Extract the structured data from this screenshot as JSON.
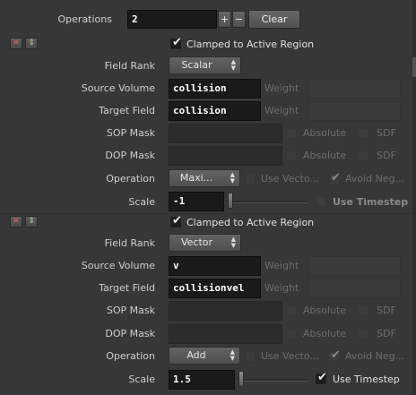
{
  "header": {
    "operations_label": "Operations",
    "operations_count": "2",
    "plus_label": "+",
    "minus_label": "−",
    "clear_label": "Clear"
  },
  "blocks": [
    {
      "close_icon": "close-icon",
      "move_icon": "up-down-icon",
      "clamped_label": "Clamped to Active Region",
      "clamped_checked": true,
      "field_rank_label": "Field Rank",
      "field_rank_value": "Scalar",
      "source_volume_label": "Source Volume",
      "source_volume_value": "collision",
      "source_weight_label": "Weight",
      "target_field_label": "Target Field",
      "target_field_value": "collision",
      "target_weight_label": "Weight",
      "sop_mask_label": "SOP Mask",
      "sop_absolute_label": "Absolute",
      "sop_sdf_label": "SDF",
      "dop_mask_label": "DOP Mask",
      "dop_absolute_label": "Absolute",
      "dop_sdf_label": "SDF",
      "operation_label": "Operation",
      "operation_value": "Maxi...",
      "use_vector_label": "Use Vecto...",
      "avoid_neg_label": "Avoid Neg...",
      "scale_label": "Scale",
      "scale_value": "-1",
      "use_timestep_label": "Use Timestep",
      "use_timestep_checked": false
    },
    {
      "close_icon": "close-icon",
      "move_icon": "up-down-icon",
      "clamped_label": "Clamped to Active Region",
      "clamped_checked": true,
      "field_rank_label": "Field Rank",
      "field_rank_value": "Vector",
      "source_volume_label": "Source Volume",
      "source_volume_value": "v",
      "source_weight_label": "Weight",
      "target_field_label": "Target Field",
      "target_field_value": "collisionvel",
      "target_weight_label": "Weight",
      "sop_mask_label": "SOP Mask",
      "sop_absolute_label": "Absolute",
      "sop_sdf_label": "SDF",
      "dop_mask_label": "DOP Mask",
      "dop_absolute_label": "Absolute",
      "dop_sdf_label": "SDF",
      "operation_label": "Operation",
      "operation_value": "Add",
      "use_vector_label": "Use Vecto...",
      "avoid_neg_label": "Avoid Neg...",
      "scale_label": "Scale",
      "scale_value": "1.5",
      "use_timestep_label": "Use Timestep",
      "use_timestep_checked": true
    }
  ],
  "colors": {
    "background": "#373737",
    "field_bg": "#1a1a1a",
    "close_red": "#e05050",
    "move_green": "#8fd07a"
  }
}
